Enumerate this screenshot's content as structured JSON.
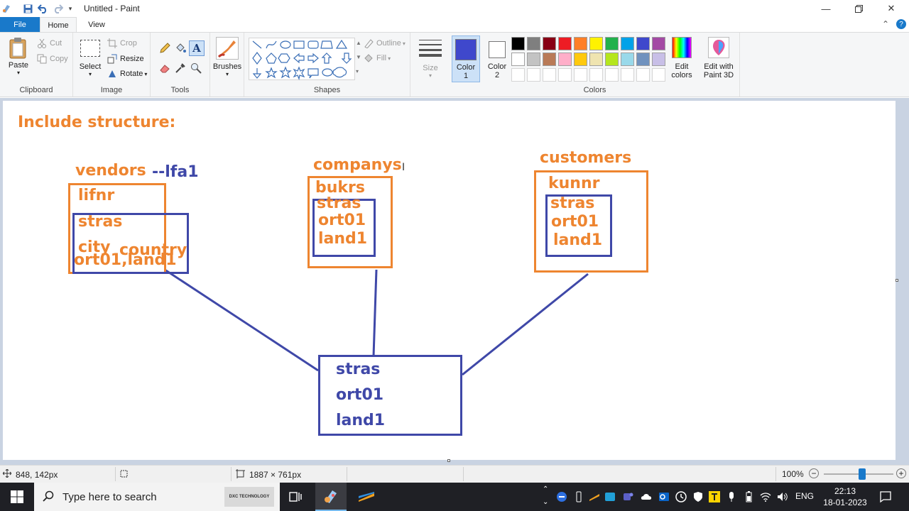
{
  "window": {
    "title": "Untitled - Paint"
  },
  "tabs": {
    "file": "File",
    "home": "Home",
    "view": "View"
  },
  "ribbon": {
    "clipboard": {
      "label": "Clipboard",
      "paste": "Paste",
      "cut": "Cut",
      "copy": "Copy"
    },
    "image": {
      "label": "Image",
      "select": "Select",
      "crop": "Crop",
      "resize": "Resize",
      "rotate": "Rotate"
    },
    "tools": {
      "label": "Tools"
    },
    "brushes": {
      "label": "Brushes"
    },
    "shapes": {
      "label": "Shapes",
      "outline": "Outline",
      "fill": "Fill"
    },
    "size": {
      "label": "Size"
    },
    "color1": {
      "label_line1": "Color",
      "label_line2": "1",
      "color": "#3f48cc"
    },
    "color2": {
      "label_line1": "Color",
      "label_line2": "2",
      "color": "#ffffff"
    },
    "colors": {
      "label": "Colors",
      "row1": [
        "#000000",
        "#7f7f7f",
        "#880015",
        "#ed1c24",
        "#ff7f27",
        "#fff200",
        "#22b14c",
        "#00a2e8",
        "#3f48cc",
        "#a349a4"
      ],
      "row2": [
        "#ffffff",
        "#c3c3c3",
        "#b97a57",
        "#ffaec9",
        "#ffc90e",
        "#efe4b0",
        "#b5e61d",
        "#99d9ea",
        "#7092be",
        "#c8bfe7"
      ]
    },
    "edit_colors": {
      "line1": "Edit",
      "line2": "colors"
    },
    "paint3d": {
      "line1": "Edit with",
      "line2": "Paint 3D"
    }
  },
  "canvas": {
    "heading": "Include structure:",
    "vendors": {
      "name": "vendors",
      "alias": "--lfa1",
      "key": "lifnr",
      "f1": "stras",
      "f2": "city",
      "f3": "country",
      "f4": "ort01,land1"
    },
    "companys": {
      "name": "companys",
      "key": "bukrs",
      "f1": "stras",
      "f2": "ort01",
      "f3": "land1"
    },
    "customers": {
      "name": "customers",
      "key": "kunnr",
      "f1": "stras",
      "f2": "ort01",
      "f3": "land1"
    },
    "structure": {
      "f1": "stras",
      "f2": "ort01",
      "f3": "land1"
    },
    "colors": {
      "orange": "#ee8530",
      "blue": "#3f48a8"
    }
  },
  "status": {
    "cursor_pos": "848, 142px",
    "image_size": "1887 × 761px",
    "zoom": "100%",
    "zoom_fraction": 0.55
  },
  "taskbar": {
    "search_placeholder": "Type here to search",
    "pinned_app": "DXC TECHNOLOGY",
    "language": "ENG",
    "time": "22:13",
    "date": "18-01-2023"
  }
}
